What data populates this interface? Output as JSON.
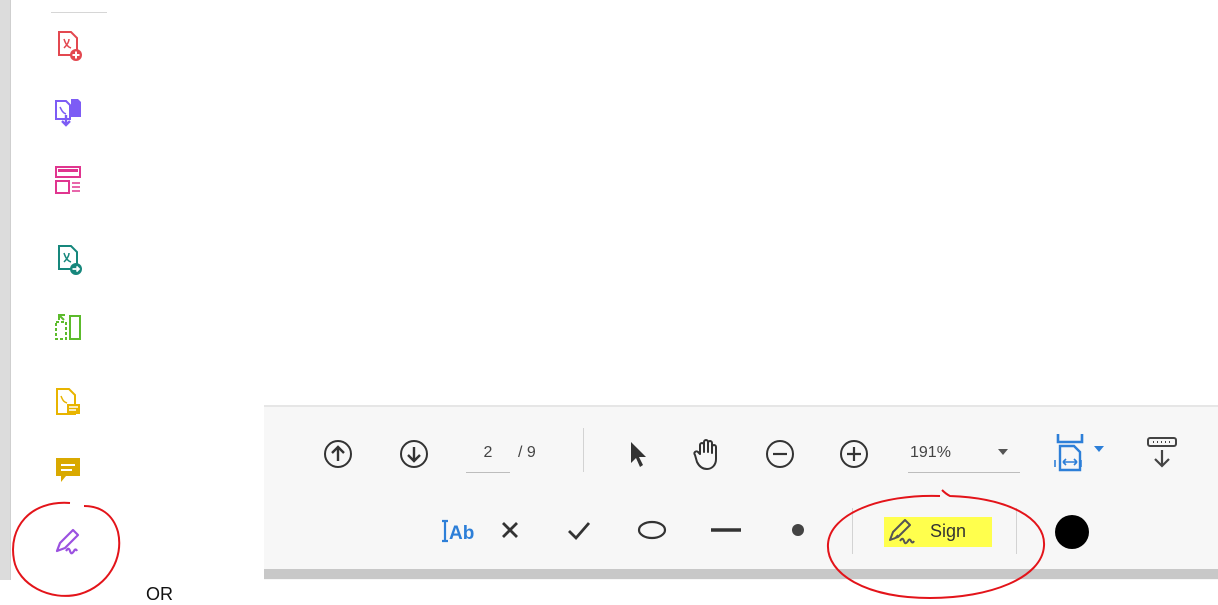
{
  "left_label": "OR",
  "rail": {
    "tools": [
      {
        "name": "create-pdf",
        "color": "#e34850"
      },
      {
        "name": "export-pdf",
        "color": "#7d5cf5"
      },
      {
        "name": "organize-pages",
        "color": "#e0358f"
      },
      {
        "name": "send-for-review",
        "color": "#16877c"
      },
      {
        "name": "compress-pdf",
        "color": "#5cbb2c"
      },
      {
        "name": "edit-pdf",
        "color": "#e8b400"
      },
      {
        "name": "comment",
        "color": "#d9a900"
      },
      {
        "name": "fill-and-sign",
        "color": "#9b51e0"
      }
    ]
  },
  "nav": {
    "page_current": "2",
    "page_total": "/ 9",
    "zoom": "191%"
  },
  "sign": {
    "label": "Sign",
    "highlight_color": "#ffff4d"
  },
  "annotation_color": "#e3141a"
}
